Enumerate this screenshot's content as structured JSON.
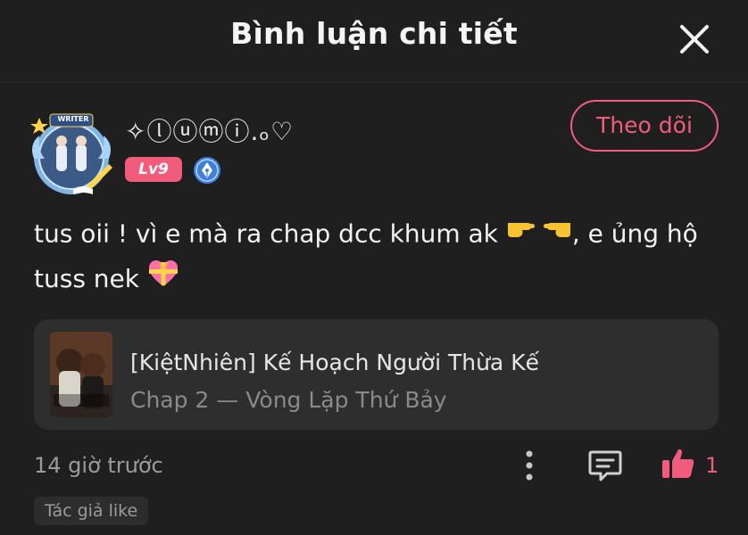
{
  "header": {
    "title": "Bình luận chi tiết",
    "close_icon": "close-icon"
  },
  "author": {
    "username": "✧ⓛⓤⓜⓘ.ₒ♡",
    "level": "Lv9",
    "avatar_badge_text": "WRITER",
    "verified_icon": "pen-nib-badge-icon"
  },
  "follow_button": {
    "label": "Theo dõi"
  },
  "comment": {
    "text_part1": "tus oii ! vì e mà ra chap dcc khum ak ",
    "text_part2": ", e ủng hộ tuss nek "
  },
  "chapter_card": {
    "story_title": "[KiệtNhiên] Kế Hoạch Người Thừa Kế",
    "chapter": "Chap 2 — Vòng Lặp Thứ Bảy"
  },
  "footer": {
    "timestamp": "14 giờ trước",
    "like_count": "1",
    "author_liked": "Tác giả like"
  },
  "colors": {
    "accent": "#f25c7c",
    "background": "#1f1f1f",
    "card": "#2e2e2e",
    "muted_text": "#9b9b9b"
  }
}
